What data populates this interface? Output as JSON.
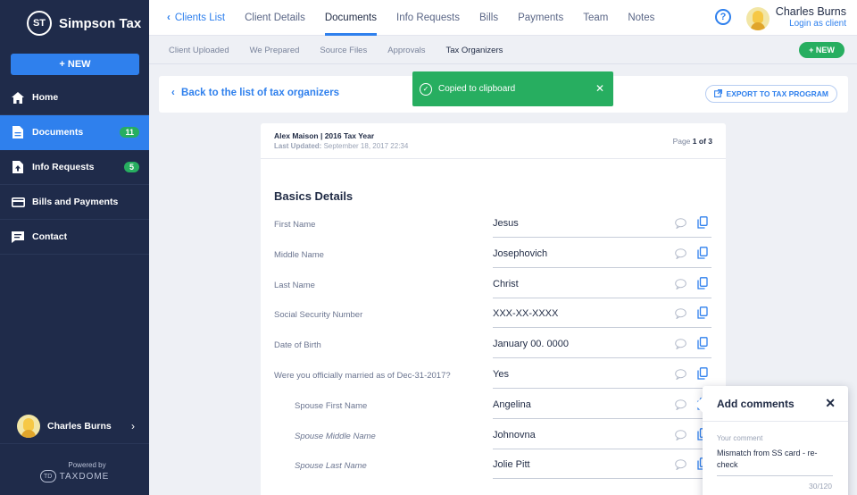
{
  "brand": {
    "logo": "ST",
    "name": "Simpson Tax"
  },
  "sidebar": {
    "new_label": "+ NEW",
    "items": [
      {
        "label": "Home",
        "icon": "home-icon",
        "badge": ""
      },
      {
        "label": "Documents",
        "icon": "document-icon",
        "badge": "11",
        "active": true
      },
      {
        "label": "Info Requests",
        "icon": "info-request-icon",
        "badge": "5"
      },
      {
        "label": "Bills and Payments",
        "icon": "credit-card-icon",
        "badge": ""
      },
      {
        "label": "Contact",
        "icon": "chat-icon",
        "badge": ""
      }
    ],
    "user": {
      "name": "Charles Burns"
    },
    "powered_by": "Powered by",
    "powered_brand": "TAXDOME",
    "powered_logo": "TD"
  },
  "header": {
    "tabs": [
      {
        "label": "Clients List"
      },
      {
        "label": "Client Details"
      },
      {
        "label": "Documents"
      },
      {
        "label": "Info Requests"
      },
      {
        "label": "Bills"
      },
      {
        "label": "Payments"
      },
      {
        "label": "Team"
      },
      {
        "label": "Notes"
      }
    ],
    "help": "?",
    "user_name": "Charles Burns",
    "login_as": "Login as client"
  },
  "subtabs": {
    "items": [
      "Client Uploaded",
      "We Prepared",
      "Source Files",
      "Approvals",
      "Tax Organizers"
    ],
    "new_label": "+ NEW"
  },
  "actionbar": {
    "back_label": "Back to the list of tax organizers",
    "export_label": "EXPORT TO TAX PROGRAM"
  },
  "toast": {
    "message": "Copied to clipboard",
    "close": "✕"
  },
  "organizer": {
    "title": "Alex Maison | 2016 Tax Year",
    "updated_label": "Last Updated:",
    "updated_value": "September 18, 2017  22:34",
    "page_label": "Page",
    "page_value": "1 of 3",
    "section": "Basics Details",
    "rows": [
      {
        "label": "First Name",
        "value": "Jesus"
      },
      {
        "label": "Middle Name",
        "value": "Josephovich"
      },
      {
        "label": "Last Name",
        "value": "Christ"
      },
      {
        "label": "Social Security Number",
        "value": "XXX-XX-XXXX"
      },
      {
        "label": "Date of Birth",
        "value": "January 00. 0000"
      },
      {
        "label": "Were you officially married as of Dec-31-2017?",
        "value": "Yes"
      },
      {
        "label": "Spouse First Name",
        "value": "Angelina"
      },
      {
        "label": "Spouse Middle Name",
        "value": "Johnovna"
      },
      {
        "label": "Spouse Last Name",
        "value": "Jolie Pitt"
      }
    ]
  },
  "comment_panel": {
    "title": "Add comments",
    "close": "✕",
    "label": "Your comment",
    "text": "Mismatch from SS card - re-check",
    "count": "30/120"
  },
  "colors": {
    "sidebar": "#1f2b4a",
    "accent": "#2f80ed",
    "success": "#27ae60"
  }
}
